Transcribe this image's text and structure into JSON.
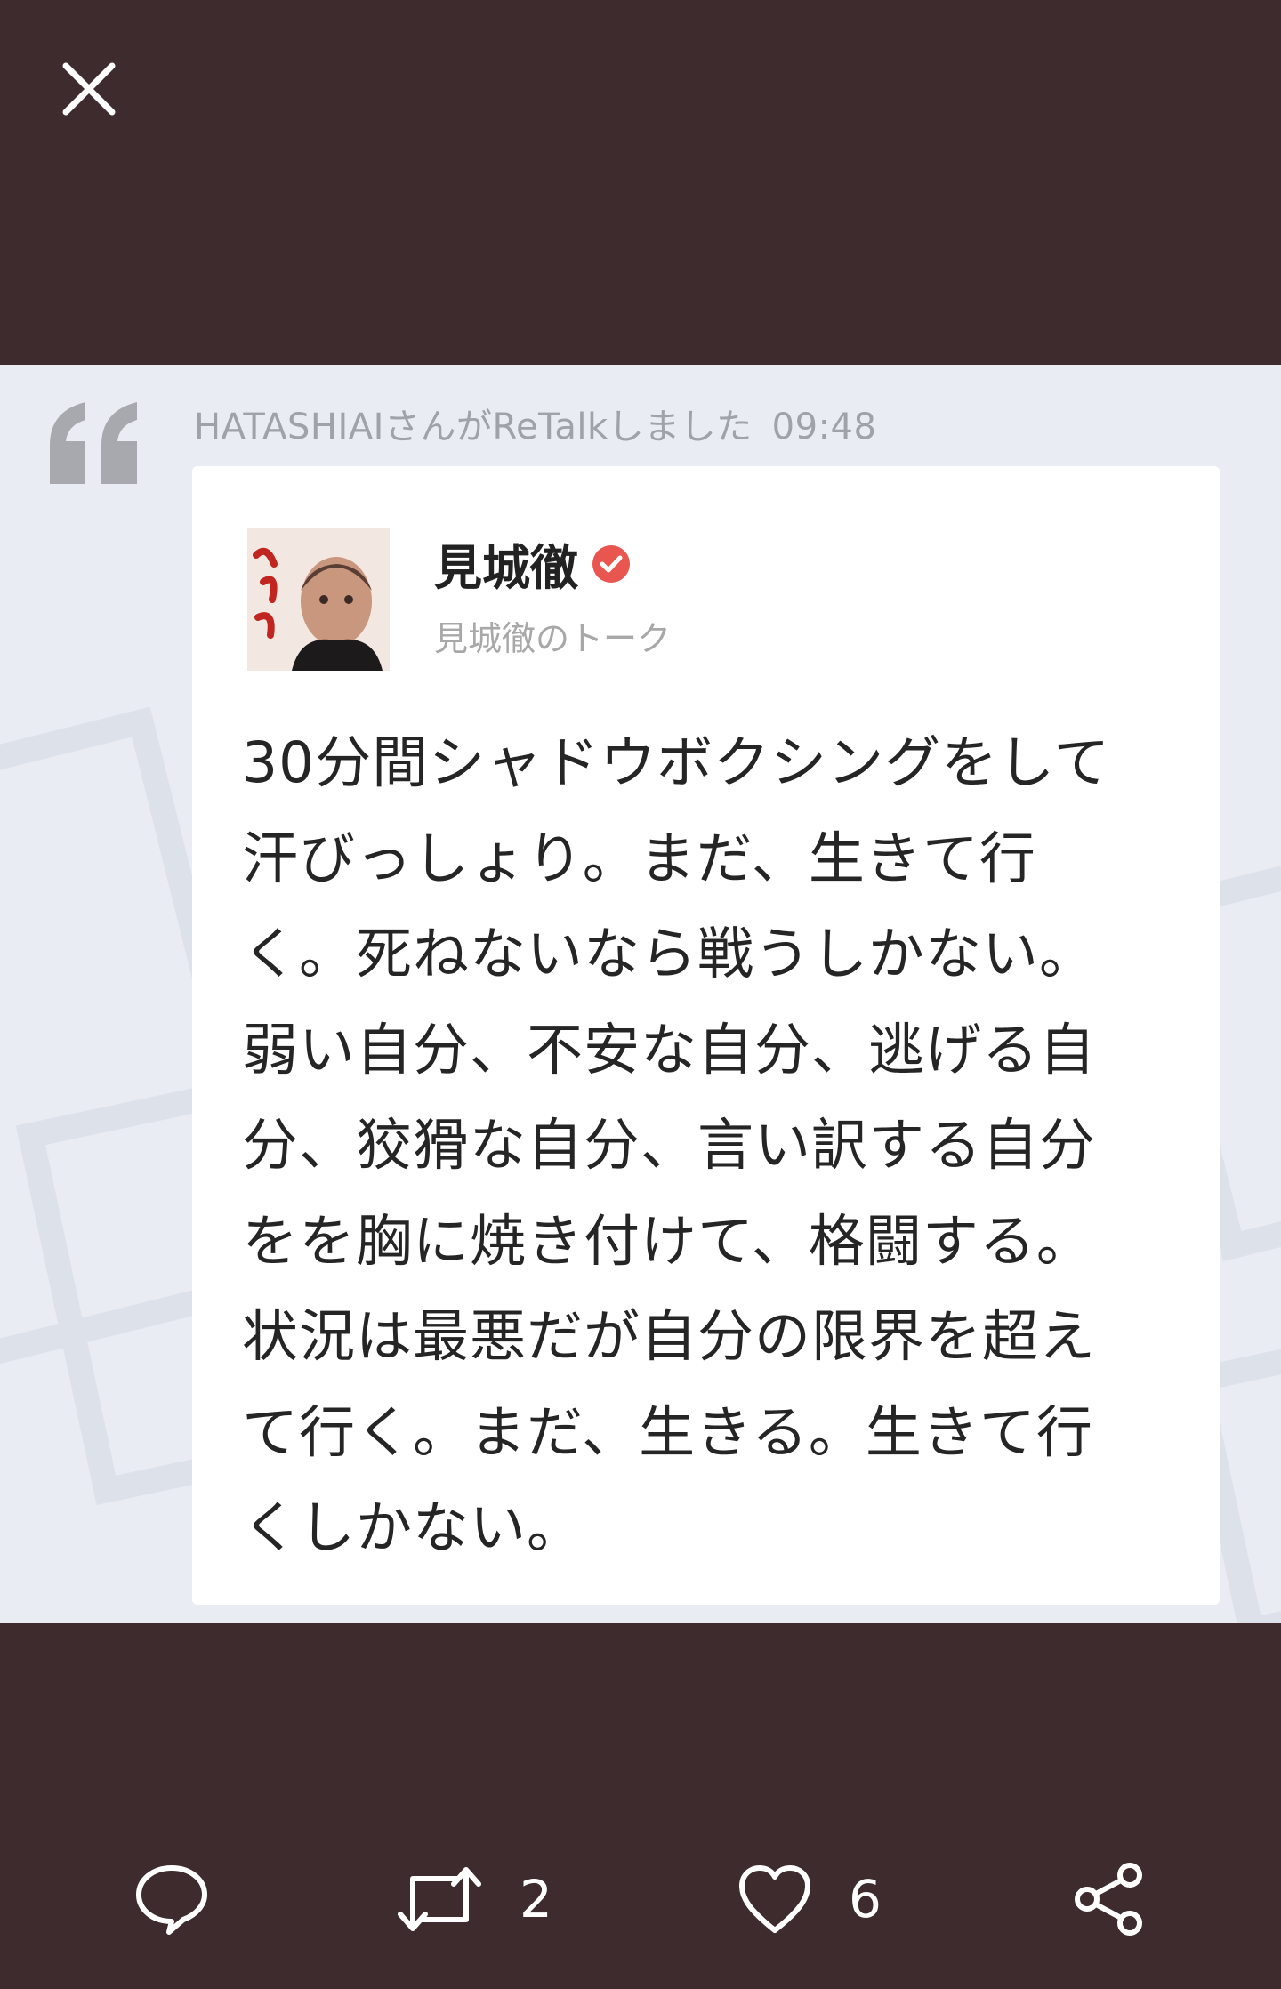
{
  "header": {
    "close_icon": "close-icon"
  },
  "retalk": {
    "label": "HATASHIAIさんがReTalkしました",
    "time": "09:48"
  },
  "post": {
    "author_name": "見城徹",
    "author_sub": "見城徹のトーク",
    "text": "30分間シャドウボクシングをして\n汗びっしょり。まだ、生きて行\nく。死ねないなら戦うしかない。\n弱い自分、不安な自分、逃げる自\n分、狡猾な自分、言い訳する自分\nをを胸に焼き付けて、格闘する。\n状況は最悪だが自分の限界を超え\nて行く。まだ、生きる。生きて行\nくしかない。"
  },
  "actions": {
    "comment_icon": "comment-icon",
    "retalk_icon": "retalk-icon",
    "retalk_count": "2",
    "like_icon": "heart-icon",
    "like_count": "6",
    "share_icon": "share-icon"
  },
  "colors": {
    "background": "#3d2b2e",
    "media_background": "#e9ecf2",
    "verified": "#e8564f"
  }
}
